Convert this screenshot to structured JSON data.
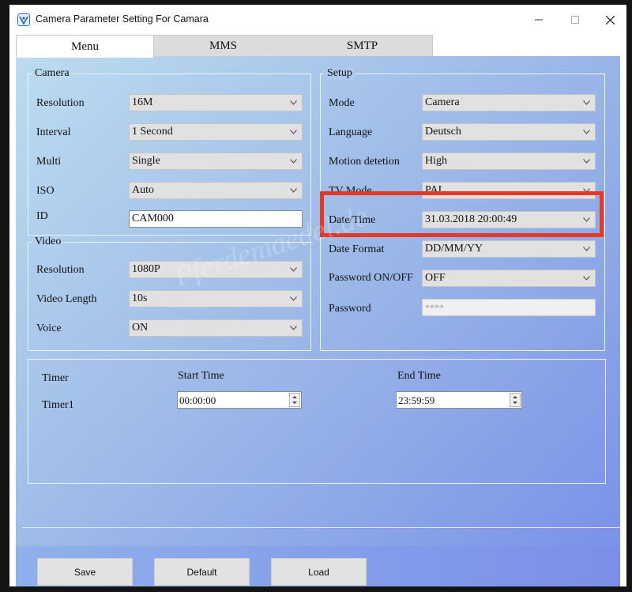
{
  "window": {
    "title": "Camera Parameter Setting For  Camara"
  },
  "tabs": [
    {
      "label": "Menu"
    },
    {
      "label": "MMS"
    },
    {
      "label": "SMTP"
    }
  ],
  "camera": {
    "legend": "Camera",
    "resolution_label": "Resolution",
    "resolution_value": "16M",
    "interval_label": "Interval",
    "interval_value": "1 Second",
    "multi_label": "Multi",
    "multi_value": "Single",
    "iso_label": "ISO",
    "iso_value": "Auto",
    "id_label": "ID",
    "id_value": "CAM000"
  },
  "video": {
    "legend": "Video",
    "resolution_label": "Resolution",
    "resolution_value": "1080P",
    "length_label": "Video Length",
    "length_value": "10s",
    "voice_label": "Voice",
    "voice_value": "ON"
  },
  "setup": {
    "legend": "Setup",
    "mode_label": "Mode",
    "mode_value": "Camera",
    "language_label": "Language",
    "language_value": "Deutsch",
    "motion_label": "Motion detetion",
    "motion_value": "High",
    "tvmode_label": "TV Mode",
    "tvmode_value": "PAL",
    "datetime_label": "Date/Time",
    "datetime_value": "31.03.2018 20:00:49",
    "dateformat_label": "Date Format",
    "dateformat_value": "DD/MM/YY",
    "password_onoff_label": "Password ON/OFF",
    "password_onoff_value": "OFF",
    "password_label": "Password",
    "password_value": "****"
  },
  "timer": {
    "timer_label": "Timer",
    "start_header": "Start Time",
    "end_header": "End Time",
    "timer1_label": "Timer1",
    "timer1_start": "00:00:00",
    "timer1_end": "23:59:59"
  },
  "watermark": "Pferdemaedel.de",
  "buttons": {
    "save": "Save",
    "default": "Default",
    "load": "Load"
  },
  "colors": {
    "highlight": "#e53826"
  }
}
